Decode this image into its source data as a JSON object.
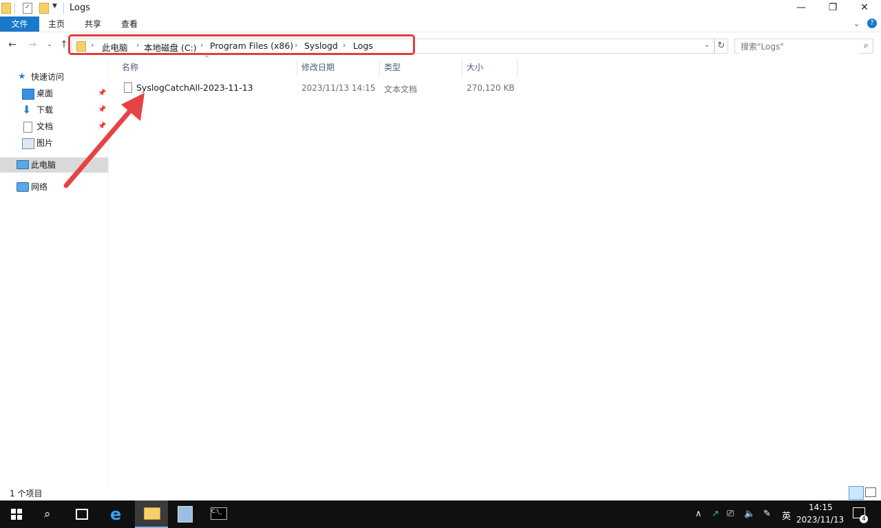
{
  "window": {
    "title": "Logs"
  },
  "ribbon": {
    "tabs": [
      "文件",
      "主页",
      "共享",
      "查看"
    ]
  },
  "address": {
    "crumbs": [
      "此电脑",
      "本地磁盘 (C:)",
      "Program Files (x86)",
      "Syslogd",
      "Logs"
    ]
  },
  "search": {
    "placeholder": "搜索\"Logs\""
  },
  "sidebar": {
    "quick_access": "快速访问",
    "items": [
      {
        "label": "桌面",
        "icon": "desktop-icon"
      },
      {
        "label": "下载",
        "icon": "download-icon"
      },
      {
        "label": "文档",
        "icon": "document-icon"
      },
      {
        "label": "图片",
        "icon": "picture-icon"
      }
    ],
    "this_pc": "此电脑",
    "network": "网络"
  },
  "columns": {
    "name": "名称",
    "date": "修改日期",
    "type": "类型",
    "size": "大小"
  },
  "files": [
    {
      "name": "SyslogCatchAll-2023-11-13",
      "date": "2023/11/13 14:15",
      "type": "文本文档",
      "size": "270,120 KB"
    }
  ],
  "status": {
    "items": "1 个项目"
  },
  "taskbar": {
    "ime": "英",
    "time": "14:15",
    "date": "2023/11/13",
    "notifications": "4"
  },
  "colors": {
    "accent": "#1979ca",
    "highlight": "#e43a3a",
    "selected": "#cce8ff"
  }
}
